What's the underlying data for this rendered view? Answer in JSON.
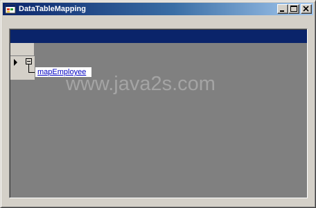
{
  "window": {
    "title": "DataTableMapping",
    "icon": "app-window-icon",
    "controls": [
      "minimize-icon",
      "maximize-icon",
      "close-icon"
    ]
  },
  "grid": {
    "relation_link": "mapEmployee",
    "row_indicator": "row-pointer-icon",
    "expander": "collapse-box-icon"
  },
  "watermark": "www.java2s.com",
  "colors": {
    "title_bar": "#0a246a",
    "grid_background": "#808080",
    "window_face": "#d4d0c8",
    "link": "#0000c0"
  }
}
